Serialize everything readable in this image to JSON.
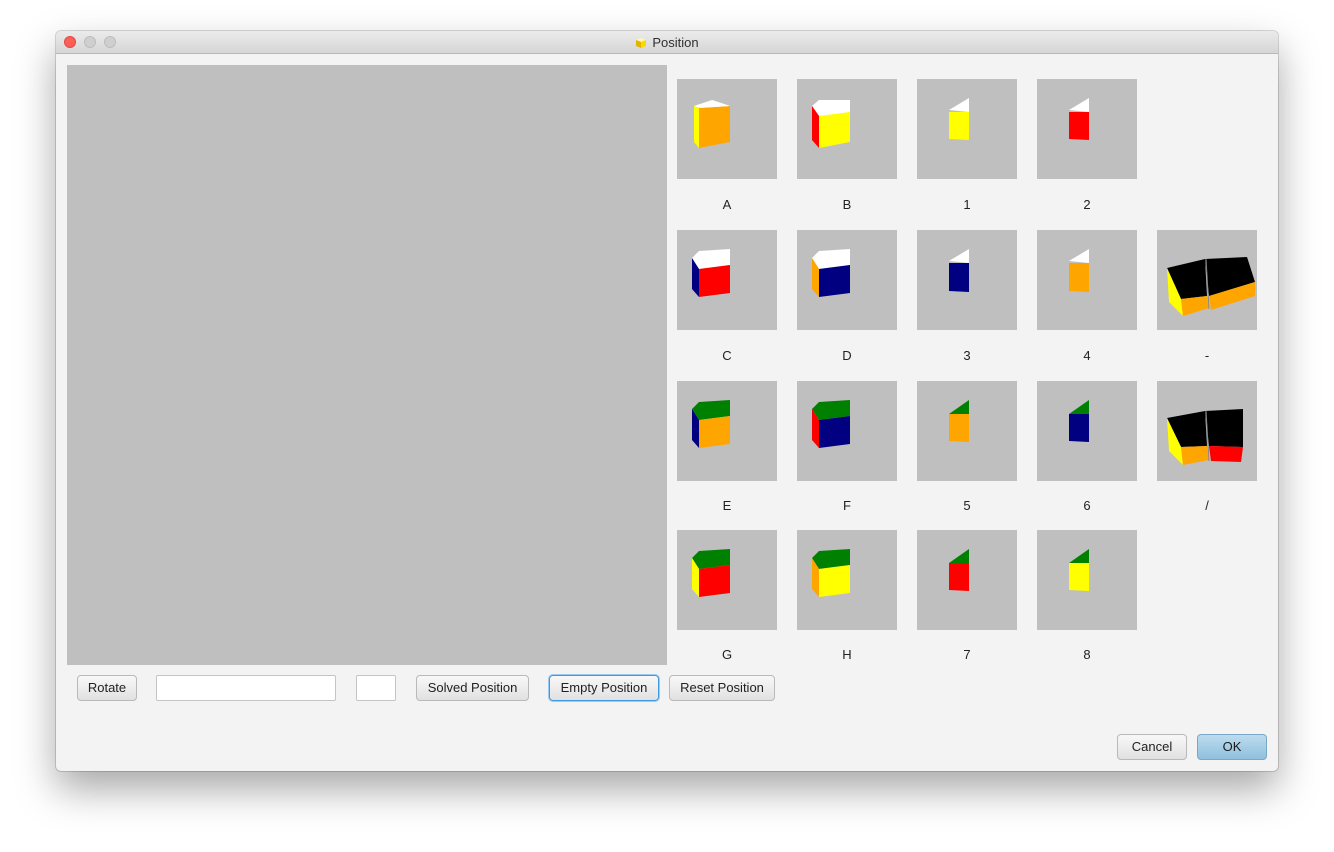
{
  "window": {
    "title": "Position"
  },
  "tiles": {
    "A": {
      "label": "A"
    },
    "B": {
      "label": "B"
    },
    "c1": {
      "label": "1"
    },
    "c2": {
      "label": "2"
    },
    "C": {
      "label": "C"
    },
    "D": {
      "label": "D"
    },
    "c3": {
      "label": "3"
    },
    "c4": {
      "label": "4"
    },
    "dash": {
      "label": "-"
    },
    "E": {
      "label": "E"
    },
    "F": {
      "label": "F"
    },
    "c5": {
      "label": "5"
    },
    "c6": {
      "label": "6"
    },
    "slash": {
      "label": "/"
    },
    "G": {
      "label": "G"
    },
    "H": {
      "label": "H"
    },
    "c7": {
      "label": "7"
    },
    "c8": {
      "label": "8"
    }
  },
  "toolbar": {
    "rotate_label": "Rotate",
    "text_value": "",
    "small_value": "",
    "solved_label": "Solved Position",
    "empty_label": "Empty Position",
    "reset_label": "Reset Position"
  },
  "footer": {
    "cancel_label": "Cancel",
    "ok_label": "OK"
  },
  "colors": {
    "white": "#ffffff",
    "yellow": "#ffff00",
    "orange": "#ffa500",
    "red": "#ff0000",
    "blue": "#000080",
    "green": "#008000",
    "black": "#000000",
    "tile_bg": "#bfbfbf"
  }
}
